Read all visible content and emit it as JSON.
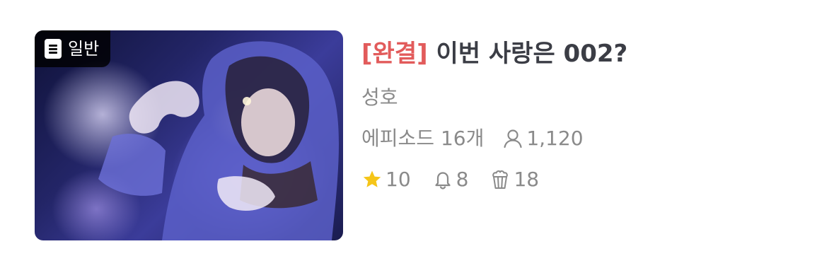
{
  "thumbnail": {
    "badge_label": "일반",
    "badge_icon": "document-icon"
  },
  "title": {
    "status_tag": "[완결]",
    "text": "이번 사랑은 002?"
  },
  "author": "성호",
  "meta": {
    "episodes": "에피소드 16개",
    "views": "1,120",
    "views_icon": "person-icon"
  },
  "stats": {
    "stars": "10",
    "stars_icon": "star-icon",
    "alarms": "8",
    "alarms_icon": "bell-icon",
    "popcorn": "18",
    "popcorn_icon": "popcorn-icon"
  },
  "colors": {
    "status_tag": "#e25b5b",
    "title": "#3b3d45",
    "secondary_text": "#8a8a8a",
    "star": "#f5c518"
  }
}
